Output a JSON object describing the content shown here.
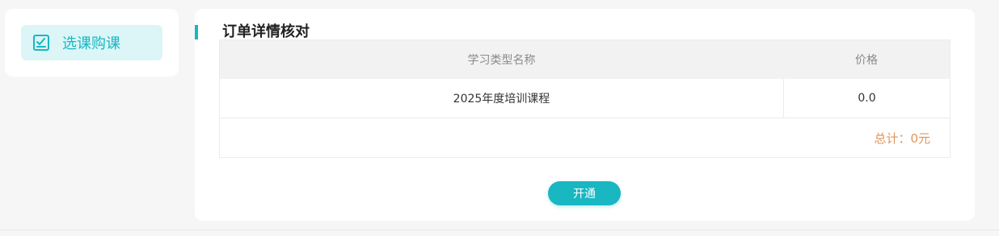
{
  "sidebar": {
    "items": [
      {
        "label": "选课购课",
        "icon": "checklist-icon",
        "active": true
      }
    ]
  },
  "main": {
    "title": "订单详情核对",
    "table": {
      "headers": [
        "学习类型名称",
        "价格"
      ],
      "rows": [
        [
          "2025年度培训课程",
          "0.0"
        ]
      ],
      "total_label": "总计：0元"
    },
    "open_button": "开通"
  },
  "colors": {
    "accent": "#18b7c2",
    "active_bg": "#dcf6f8",
    "total": "#e0945c"
  }
}
